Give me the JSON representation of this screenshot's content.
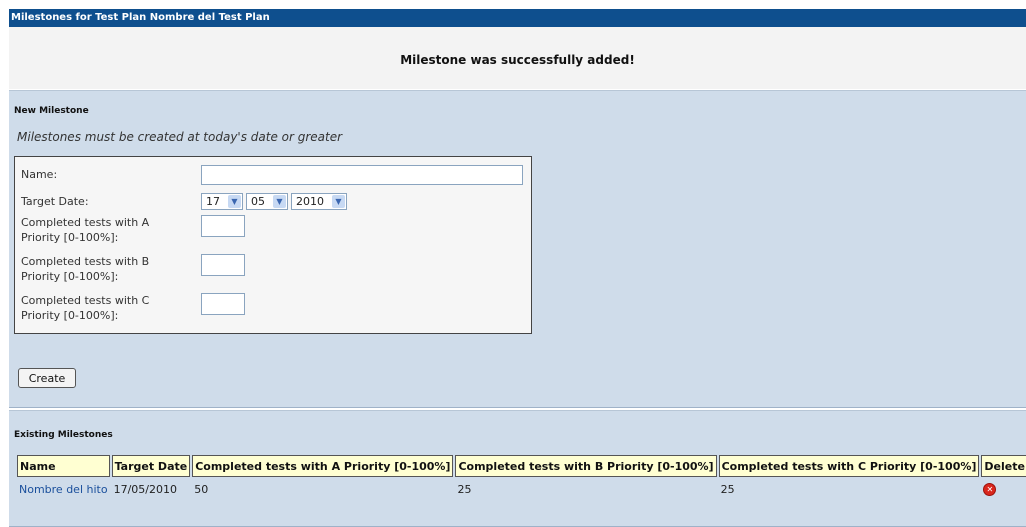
{
  "window": {
    "title": "Milestones for Test Plan Nombre del Test Plan"
  },
  "notice": {
    "message": "Milestone was successfully added!"
  },
  "new_milestone": {
    "title": "New Milestone",
    "hint": "Milestones must be created at today's date or greater",
    "fields": {
      "name_label": "Name:",
      "name_value": "",
      "target_date_label": "Target Date:",
      "day": "17",
      "month": "05",
      "year": "2010",
      "a_label": "Completed tests with A Priority [0-100%]:",
      "a_value": "",
      "b_label": "Completed tests with B Priority [0-100%]:",
      "b_value": "",
      "c_label": "Completed tests with C Priority [0-100%]:",
      "c_value": ""
    },
    "create_label": "Create"
  },
  "existing": {
    "title": "Existing Milestones",
    "columns": [
      "Name",
      "Target Date",
      "Completed tests with A Priority [0-100%]",
      "Completed tests with B Priority [0-100%]",
      "Completed tests with C Priority [0-100%]",
      "Delete"
    ],
    "rows": [
      {
        "name": "Nombre del hito",
        "target_date": "17/05/2010",
        "a": "50",
        "b": "25",
        "c": "25",
        "delete_icon": "delete-icon"
      }
    ]
  },
  "colors": {
    "titlebar": "#0e4f8e",
    "panel": "#cfdcea",
    "header_cell": "#ffffd2",
    "link": "#1a4f9c",
    "delete": "#d9261c"
  }
}
